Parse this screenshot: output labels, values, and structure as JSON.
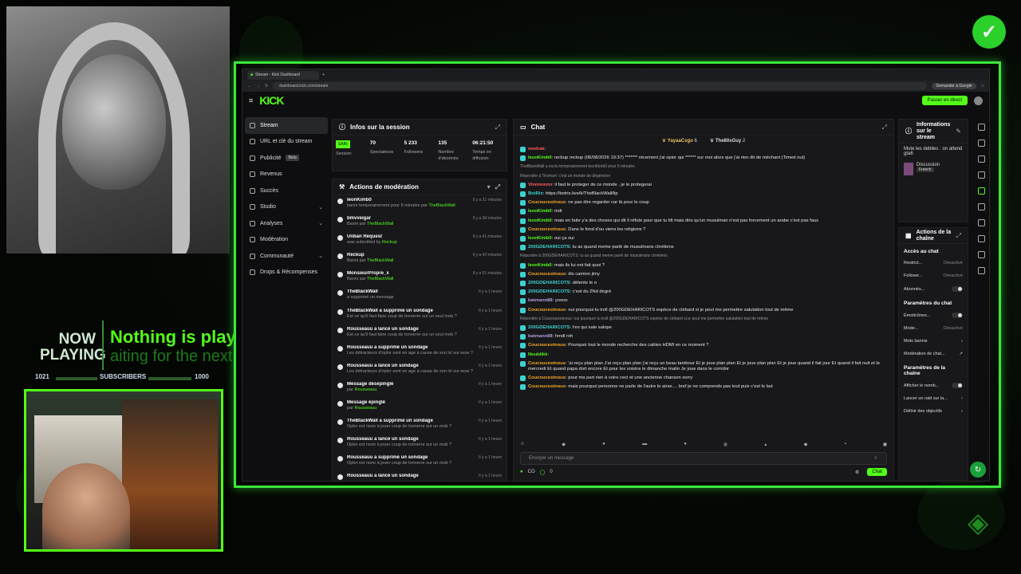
{
  "colors": {
    "accent": "#53fc18",
    "mod_name": "#53fc18",
    "chat_name_cyan": "#3fd0d0",
    "chat_name_orange": "#f5a623",
    "chat_name_purple": "#b39ddb"
  },
  "overlay": {
    "now": "NOW",
    "playing": "PLAYING",
    "nothing": "Nothing is playing",
    "waiting": "aiting for the next tr",
    "sub_left": "1021",
    "subscribers": "SUBSCRIBERS",
    "sub_right": "1000"
  },
  "browser": {
    "tab_title": "Stream - Kick Dashboard",
    "url": "dashboard.kick.com/stream",
    "ask_google": "Demander à Google"
  },
  "kick": {
    "logo": "KICK",
    "live_button": "Passer en direct"
  },
  "nav": [
    {
      "label": "Stream"
    },
    {
      "label": "URL et clé du stream"
    },
    {
      "label": "Publicité",
      "badge": "Beta"
    },
    {
      "label": "Revenus"
    },
    {
      "label": "Succès"
    },
    {
      "label": "Studio"
    },
    {
      "label": "Analyses"
    },
    {
      "label": "Modération"
    },
    {
      "label": "Communauté"
    },
    {
      "label": "Drops & Récompenses"
    }
  ],
  "info": {
    "title": "Infos sur la session",
    "sain": "SAIN",
    "session": "Session",
    "viewers": "70",
    "viewers_label": "Spectateurs",
    "followers": "5 233",
    "followers_label": "Followers",
    "subs": "135",
    "subs_label": "Nombre d'abonnés",
    "time": "06:21:50",
    "time_label": "Temps en diffusion"
  },
  "mod": {
    "title": "Actions de modération",
    "items": [
      {
        "name": "leonKimb0",
        "detail": "banni temporairement pour 5 minutes par ",
        "by": "TheBlackWall",
        "time": "Il y a 31 minutes"
      },
      {
        "name": "bmvveigar",
        "detail": "Banni par ",
        "by": "TheBlackWall",
        "time": "Il y a 38 minutes"
      },
      {
        "name": "Unban Request",
        "detail": "was submitted by ",
        "by": "Reckup",
        "time": "Il y a 41 minutes"
      },
      {
        "name": "Reckup",
        "detail": "Banni par ",
        "by": "TheBlackWall",
        "time": "Il y a 42 minutes"
      },
      {
        "name": "MonsieurPropre_x",
        "detail": "Banni par ",
        "by": "TheBlackWall",
        "time": "Il y a 51 minutes"
      },
      {
        "name": "TheBlackWall",
        "detail": "a supprimé un message",
        "by": "",
        "time": "Il y a 1 heure"
      },
      {
        "name": "TheBlackWall a supprimé un sondage",
        "detail": "Est ce qu'il faut faire coup de tonnerre sur un seul mob ?",
        "by": "",
        "time": "Il y a 1 heure"
      },
      {
        "name": "Rousseauu a lancé un sondage",
        "detail": "Est ce qu'il faut faire coup de tonnerre sur un seul mob ?",
        "by": "",
        "time": "Il y a 1 heure"
      },
      {
        "name": "Rousseauu a supprimé un sondage",
        "detail": "Les détracteurs d'oplor sont en age à cause de son lvl sur wow ?",
        "by": "",
        "time": "Il y a 1 heure"
      },
      {
        "name": "Rousseauu a lancé un sondage",
        "detail": "Les détracteurs d'oplor sont en age à cause de son lvl sur wow ?",
        "by": "",
        "time": "Il y a 1 heure"
      },
      {
        "name": "Message désépinglé",
        "detail": "par ",
        "by": "Rousseauu",
        "time": "Il y a 1 heure"
      },
      {
        "name": "Message épinglé",
        "detail": "par ",
        "by": "Rousseauu",
        "time": "Il y a 1 heure"
      },
      {
        "name": "TheBlackWall a supprimé un sondage",
        "detail": "Oplor est nooo à jouer coup de tonnerre sur un mob ?",
        "by": "",
        "time": "Il y a 1 heure"
      },
      {
        "name": "Rousseauu a lancé un sondage",
        "detail": "Oplor est nooo à jouer coup de tonnerre sur un mob ?",
        "by": "",
        "time": "Il y a 1 heure"
      },
      {
        "name": "Rousseauu a supprimé un sondage",
        "detail": "Oplor est nooo à jouer coup de tonnerre sur un mob ?",
        "by": "",
        "time": "Il y a 1 heure"
      },
      {
        "name": "Rousseauu a lancé un sondage",
        "detail": "",
        "by": "",
        "time": "Il y a 1 heure"
      }
    ]
  },
  "chat": {
    "title": "Chat",
    "pin1": "YayaaCsgo",
    "pin1n": "6",
    "pin2": "The80sGuy",
    "pin2n": "2",
    "messages": [
      {
        "user": "medrak",
        "color": "#ff5a5a",
        "text": ""
      },
      {
        "user": "leonKimb0",
        "color": "#53fc18",
        "text": "reckup reckup (06/08/2026 19:37) ******* récement j'ai opior qui ****** sur moi alors que j'ai rien dit de méchant (Timed out)"
      },
      {
        "sys": "TheBlackWall a exclu temporairement leonKimb0 pour 5 minutes."
      },
      {
        "sys": "Répondre à Tiromarl: c'est un monde de dégénérer"
      },
      {
        "user": "Vinnnnnnn",
        "color": "#ff5a5a",
        "text": "il faut le proteger de ce monde , je le protegerai"
      },
      {
        "user": "BotRix",
        "color": "#3fd0d0",
        "text": "https://botrix.live/k/TheBlackWall/lip"
      },
      {
        "user": "Coucoucestnous",
        "color": "#f5a623",
        "text": "ne pas dire regarder car là pour le coup"
      },
      {
        "user": "leonKimb0",
        "color": "#53fc18",
        "text": "mdr"
      },
      {
        "user": "leonKimb0",
        "color": "#53fc18",
        "text": "mais en faite y'a des choses qui dit il réfute pour que tu tilt mais dire qu'un musulman n'est pas forcement un arabe c'est pas faux"
      },
      {
        "user": "Coucoucestnous",
        "color": "#f5a623",
        "text": "Dans le fond d'ou viens les religions ?"
      },
      {
        "user": "leonKimb0",
        "color": "#53fc18",
        "text": "oui ça oui"
      },
      {
        "user": "200GDEHARICOTS",
        "color": "#3fd0d0",
        "text": "tu as quand meme parlé de musulmans chrétiens"
      },
      {
        "sys": "Répondre à 200GDEHARICOTS: tu as quand meme parlé de musulmans chrétiens"
      },
      {
        "user": "leonKimb0",
        "color": "#53fc18",
        "text": "mais ils lui ont fait quoi ?"
      },
      {
        "user": "Coucoucestnous",
        "color": "#f5a623",
        "text": "dis camion jimy"
      },
      {
        "user": "200GDEHARICOTS",
        "color": "#3fd0d0",
        "text": "détente le o"
      },
      {
        "user": "200GDEHARICOTS",
        "color": "#3fd0d0",
        "text": "c'est du 2Nd degré"
      },
      {
        "user": "batmann88",
        "color": "#b39ddb",
        "text": "yoooo"
      },
      {
        "user": "Coucoucestnous",
        "color": "#f5a623",
        "text": "oui pourquoi tu troll @200GDEHARICOTS espèce de clébard si je peut me permettre salutation tout de même"
      },
      {
        "sys": "Répondre à Coucoucestnous: oui pourquoi tu troll @200GDEHARICOTS espèce de clébard si je peut me permettre salutation tout de même"
      },
      {
        "user": "200GDEHARICOTS",
        "color": "#3fd0d0",
        "text": "t'es qui sale salope"
      },
      {
        "user": "batmann88",
        "color": "#b39ddb",
        "text": "hmdl roh"
      },
      {
        "user": "Coucoucestnous",
        "color": "#f5a623",
        "text": "Pourquoi tout le monde recherche des cables HDMI en ce moment ?"
      },
      {
        "user": "Noublikk",
        "color": "#53fc18",
        "text": ""
      },
      {
        "user": "Coucoucestnous",
        "color": "#f5a623",
        "text": "'ai reçu plan plan J'ai reçu plan plan j'ai reçu un beau tambour Et je joue plan plan Et je joue plan plan Et je joue quand il fait jour Et quand il fait nuit et le mercredi Et quand papa dort encore Et pour les voisins le dimanche matin Je joue dans le corridor"
      },
      {
        "user": "Coucoucestnous",
        "color": "#f5a623",
        "text": "pour ma part rien à voire ceci et une ancienne chanson sorry"
      },
      {
        "user": "Coucoucestnous",
        "color": "#f5a623",
        "text": "mais pourquoi personne ne parle de l'autre le airse.... bref je ne comprends pas tout puis c'est le but"
      }
    ],
    "placeholder": "Envoyer un message",
    "points": "CO",
    "zero": "0",
    "send": "Chat"
  },
  "stream_info": {
    "title": "Informations sur le stream",
    "text": "Mute les debiles : on attend gta6",
    "category": "Discussion",
    "lang": "French"
  },
  "chan": {
    "title": "Actions de la chaîne",
    "h1": "Accès au chat",
    "r1": "Restrict...",
    "r1v": "Désactivé",
    "r2": "Followe...",
    "r2v": "Désactivé",
    "r3": "Abonnés...",
    "h2": "Paramètres du chat",
    "r4": "Émoticônes...",
    "r5": "Mode...",
    "r5v": "Désactivé",
    "r6": "Mots bannis",
    "r7": "Modération de chat...",
    "h3": "Paramètres de la chaîne",
    "r8": "Afficher le nomb...",
    "r9": "Lancer un raid sur la...",
    "r10": "Définir des objectifs"
  }
}
